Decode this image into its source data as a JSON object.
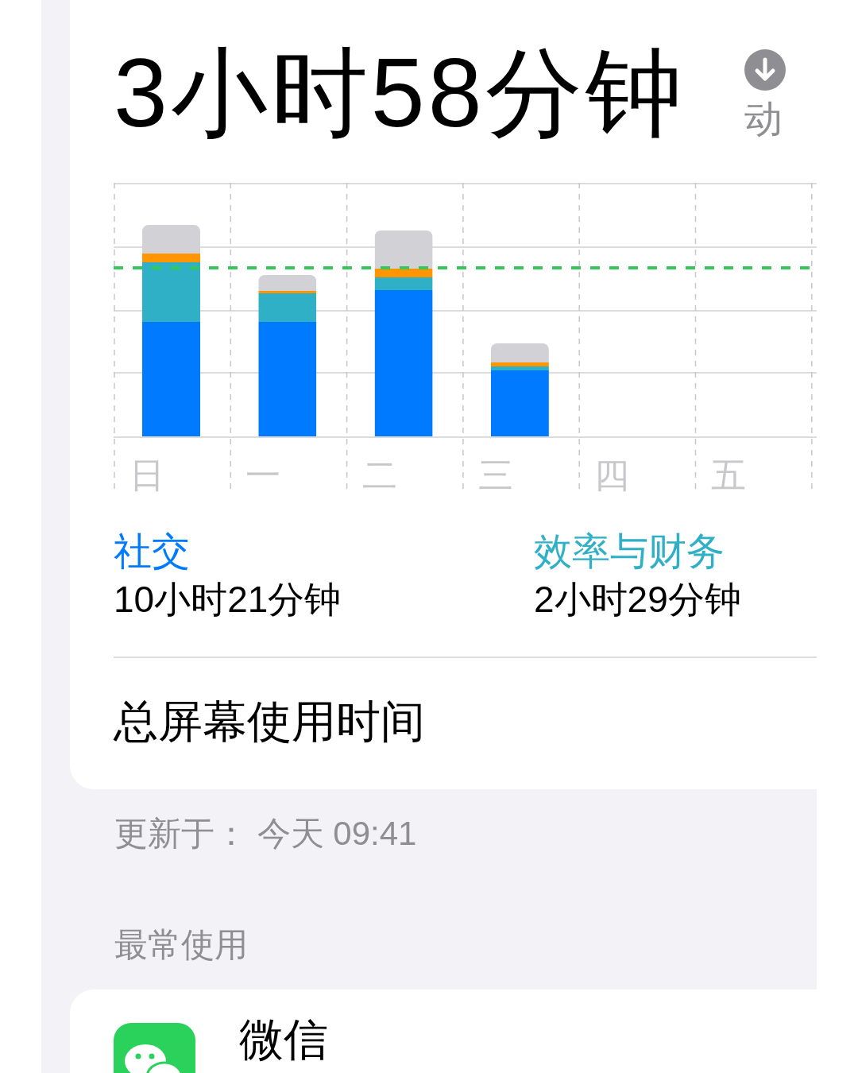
{
  "summary": {
    "total": "3小时58分钟",
    "trend_text": "动"
  },
  "chart": {
    "day_labels": [
      "日",
      "一",
      "二",
      "三",
      "四",
      "五"
    ]
  },
  "categories": [
    {
      "name": "社交",
      "time": "10小时21分钟",
      "color": "#007aff"
    },
    {
      "name": "效率与财务",
      "time": "2小时29分钟",
      "color": "#30b0c7"
    }
  ],
  "total_row": {
    "label": "总屏幕使用时间"
  },
  "updated": "更新于： 今天 09:41",
  "most_used": {
    "header": "最常使用",
    "apps": [
      {
        "name": "微信"
      }
    ]
  }
}
